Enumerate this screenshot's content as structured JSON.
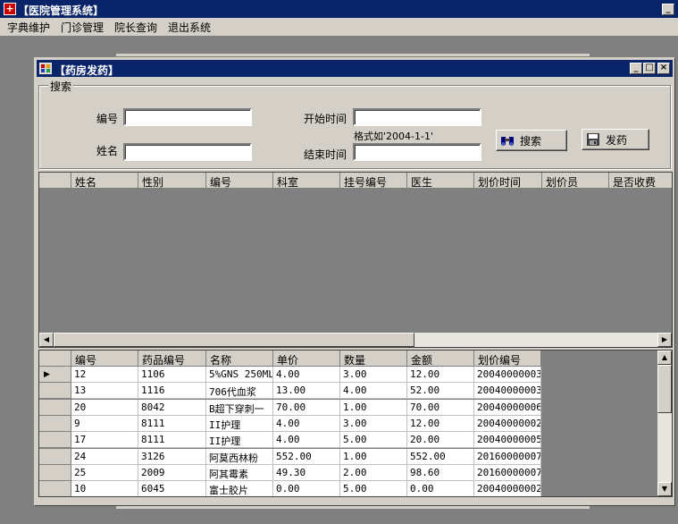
{
  "app": {
    "title": "【医院管理系统】",
    "icon": "hospital-cross-icon"
  },
  "menu": [
    "字典维护",
    "门诊管理",
    "院长查询",
    "退出系统"
  ],
  "window": {
    "title": "【药房发药】",
    "icon": "form-window-icon"
  },
  "search": {
    "group_label": "搜索",
    "id_label": "编号",
    "id_value": "",
    "name_label": "姓名",
    "name_value": "",
    "start_label": "开始时间",
    "start_value": "",
    "format_hint": "格式如'2004-1-1'",
    "end_label": "结束时间",
    "end_value": "",
    "search_button": "搜索",
    "search_icon": "binoculars-icon",
    "dispense_button": "发药",
    "dispense_icon": "save-disk-icon"
  },
  "upper_grid": {
    "columns": [
      "姓名",
      "性别",
      "编号",
      "科室",
      "挂号编号",
      "医生",
      "划价时间",
      "划价员",
      "是否收费"
    ],
    "rows": []
  },
  "lower_grid": {
    "columns": [
      "编号",
      "药品编号",
      "名称",
      "单价",
      "数量",
      "金额",
      "划价编号"
    ],
    "rows": [
      [
        "12",
        "1106",
        "5%GNS 250ML",
        "4.00",
        "3.00",
        "12.00",
        "20040000003"
      ],
      [
        "13",
        "1116",
        "706代血浆",
        "13.00",
        "4.00",
        "52.00",
        "20040000003"
      ],
      [
        "20",
        "8042",
        "B超下穿刺一",
        "70.00",
        "1.00",
        "70.00",
        "20040000006"
      ],
      [
        "9",
        "8111",
        "II护理",
        "4.00",
        "3.00",
        "12.00",
        "20040000002"
      ],
      [
        "17",
        "8111",
        "II护理",
        "4.00",
        "5.00",
        "20.00",
        "20040000005"
      ],
      [
        "24",
        "3126",
        "阿莫西林粉",
        "552.00",
        "1.00",
        "552.00",
        "20160000007"
      ],
      [
        "25",
        "2009",
        "阿其霉素",
        "49.30",
        "2.00",
        "98.60",
        "20160000007"
      ],
      [
        "10",
        "6045",
        "富士胶片",
        "0.00",
        "5.00",
        "0.00",
        "20040000002"
      ]
    ],
    "current_row": 0
  }
}
